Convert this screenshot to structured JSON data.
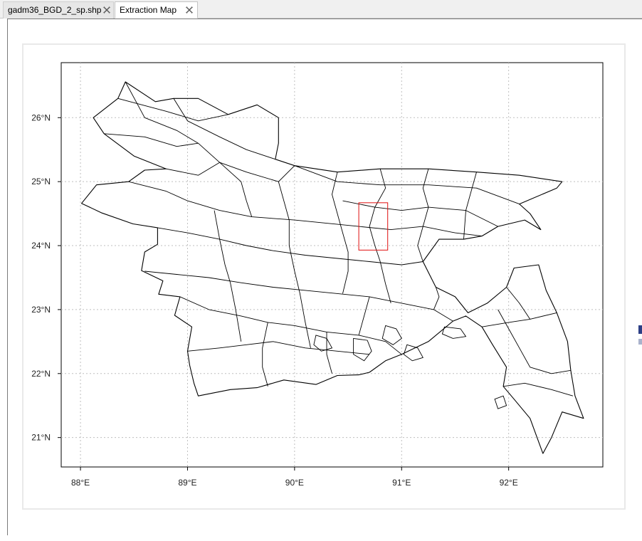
{
  "tabs": [
    {
      "label": "gadm36_BGD_2_sp.shp",
      "active": false
    },
    {
      "label": "Extraction Map",
      "active": true
    }
  ],
  "map": {
    "extent": {
      "lon_min": 87.82,
      "lon_max": 92.88,
      "lat_min": 20.54,
      "lat_max": 26.86
    },
    "x_ticks": [
      {
        "value": 88,
        "label": "88°E"
      },
      {
        "value": 89,
        "label": "89°E"
      },
      {
        "value": 90,
        "label": "90°E"
      },
      {
        "value": 91,
        "label": "91°E"
      },
      {
        "value": 92,
        "label": "92°E"
      }
    ],
    "y_ticks": [
      {
        "value": 26,
        "label": "26°N"
      },
      {
        "value": 25,
        "label": "25°N"
      },
      {
        "value": 24,
        "label": "24°N"
      },
      {
        "value": 23,
        "label": "23°N"
      },
      {
        "value": 22,
        "label": "22°N"
      },
      {
        "value": 21,
        "label": "21°N"
      }
    ],
    "grid": true,
    "grid_color": "#bfbfbf",
    "boundary_color": "#000000",
    "extraction_box": {
      "lon_min": 90.6,
      "lon_max": 90.87,
      "lat_min": 23.93,
      "lat_max": 24.67,
      "color": "#e01010"
    },
    "country_outline": [
      [
        88.01,
        24.66
      ],
      [
        88.2,
        24.51
      ],
      [
        88.49,
        24.34
      ],
      [
        88.72,
        24.28
      ],
      [
        88.72,
        24.02
      ],
      [
        88.6,
        23.9
      ],
      [
        88.57,
        23.61
      ],
      [
        88.77,
        23.45
      ],
      [
        88.73,
        23.24
      ],
      [
        88.93,
        23.2
      ],
      [
        88.88,
        22.91
      ],
      [
        89.04,
        22.73
      ],
      [
        89.0,
        22.35
      ],
      [
        89.02,
        22.13
      ],
      [
        89.06,
        21.85
      ],
      [
        89.1,
        21.65
      ],
      [
        89.4,
        21.75
      ],
      [
        89.65,
        21.78
      ],
      [
        89.9,
        21.9
      ],
      [
        90.2,
        21.83
      ],
      [
        90.4,
        21.97
      ],
      [
        90.6,
        21.98
      ],
      [
        90.7,
        22.02
      ],
      [
        90.85,
        22.2
      ],
      [
        91.0,
        22.3
      ],
      [
        91.25,
        22.5
      ],
      [
        91.48,
        22.82
      ],
      [
        91.6,
        22.9
      ],
      [
        91.75,
        22.73
      ],
      [
        91.85,
        22.45
      ],
      [
        91.98,
        22.1
      ],
      [
        91.95,
        21.8
      ],
      [
        92.05,
        21.6
      ],
      [
        92.2,
        21.3
      ],
      [
        92.32,
        20.75
      ],
      [
        92.4,
        21.0
      ],
      [
        92.5,
        21.4
      ],
      [
        92.7,
        21.3
      ],
      [
        92.62,
        21.65
      ],
      [
        92.58,
        22.05
      ],
      [
        92.55,
        22.5
      ],
      [
        92.45,
        22.95
      ],
      [
        92.35,
        23.3
      ],
      [
        92.28,
        23.7
      ],
      [
        92.05,
        23.65
      ],
      [
        91.98,
        23.35
      ],
      [
        91.8,
        23.1
      ],
      [
        91.62,
        22.95
      ],
      [
        91.5,
        23.2
      ],
      [
        91.32,
        23.35
      ],
      [
        91.2,
        23.75
      ],
      [
        91.35,
        24.1
      ],
      [
        91.58,
        24.1
      ],
      [
        91.75,
        24.15
      ],
      [
        91.9,
        24.3
      ],
      [
        92.15,
        24.4
      ],
      [
        92.3,
        24.25
      ],
      [
        92.2,
        24.5
      ],
      [
        92.1,
        24.65
      ],
      [
        92.45,
        24.9
      ],
      [
        92.5,
        25.0
      ],
      [
        92.1,
        25.1
      ],
      [
        91.7,
        25.15
      ],
      [
        91.25,
        25.2
      ],
      [
        90.8,
        25.2
      ],
      [
        90.4,
        25.15
      ],
      [
        90.0,
        25.25
      ],
      [
        89.82,
        25.35
      ],
      [
        89.85,
        25.6
      ],
      [
        89.85,
        26.0
      ],
      [
        89.65,
        26.2
      ],
      [
        89.38,
        26.05
      ],
      [
        89.1,
        26.3
      ],
      [
        88.87,
        26.3
      ],
      [
        88.7,
        26.25
      ],
      [
        88.42,
        26.56
      ],
      [
        88.35,
        26.3
      ],
      [
        88.12,
        26.0
      ],
      [
        88.22,
        25.75
      ],
      [
        88.5,
        25.4
      ],
      [
        88.8,
        25.2
      ],
      [
        88.6,
        25.18
      ],
      [
        88.45,
        25.0
      ],
      [
        88.15,
        24.95
      ],
      [
        88.01,
        24.66
      ]
    ],
    "district_lines": [
      [
        [
          88.45,
          25.0
        ],
        [
          88.8,
          24.85
        ],
        [
          89.0,
          24.7
        ],
        [
          89.3,
          24.55
        ],
        [
          89.6,
          24.45
        ],
        [
          90.0,
          24.4
        ],
        [
          90.3,
          24.35
        ],
        [
          90.6,
          24.3
        ],
        [
          90.9,
          24.25
        ],
        [
          91.2,
          24.3
        ],
        [
          91.5,
          24.2
        ],
        [
          91.75,
          24.15
        ]
      ],
      [
        [
          88.72,
          24.28
        ],
        [
          89.0,
          24.2
        ],
        [
          89.3,
          24.1
        ],
        [
          89.55,
          24.0
        ],
        [
          89.8,
          23.92
        ],
        [
          90.1,
          23.85
        ],
        [
          90.4,
          23.8
        ],
        [
          90.7,
          23.75
        ],
        [
          91.0,
          23.7
        ],
        [
          91.2,
          23.75
        ]
      ],
      [
        [
          88.6,
          23.6
        ],
        [
          88.9,
          23.55
        ],
        [
          89.2,
          23.5
        ],
        [
          89.5,
          23.42
        ],
        [
          89.8,
          23.35
        ],
        [
          90.1,
          23.3
        ],
        [
          90.4,
          23.25
        ],
        [
          90.7,
          23.2
        ],
        [
          91.0,
          23.1
        ],
        [
          91.3,
          23.0
        ],
        [
          91.48,
          22.82
        ]
      ],
      [
        [
          88.93,
          23.2
        ],
        [
          89.2,
          23.0
        ],
        [
          89.5,
          22.9
        ],
        [
          89.75,
          22.8
        ],
        [
          90.0,
          22.75
        ],
        [
          90.3,
          22.65
        ],
        [
          90.6,
          22.6
        ],
        [
          90.85,
          22.5
        ],
        [
          91.0,
          22.3
        ]
      ],
      [
        [
          89.0,
          22.35
        ],
        [
          89.3,
          22.4
        ],
        [
          89.55,
          22.45
        ],
        [
          89.8,
          22.5
        ],
        [
          90.1,
          22.4
        ],
        [
          90.4,
          22.35
        ],
        [
          90.7,
          22.3
        ]
      ],
      [
        [
          88.42,
          26.56
        ],
        [
          88.6,
          26.0
        ],
        [
          88.9,
          25.8
        ],
        [
          89.1,
          25.6
        ],
        [
          89.3,
          25.3
        ],
        [
          89.5,
          25.0
        ],
        [
          89.55,
          24.7
        ],
        [
          89.6,
          24.45
        ]
      ],
      [
        [
          88.87,
          26.3
        ],
        [
          89.0,
          25.95
        ],
        [
          89.3,
          25.7
        ],
        [
          89.55,
          25.5
        ],
        [
          89.82,
          25.35
        ]
      ],
      [
        [
          88.35,
          26.3
        ],
        [
          88.8,
          26.1
        ],
        [
          89.1,
          25.95
        ],
        [
          89.38,
          26.05
        ]
      ],
      [
        [
          88.22,
          25.75
        ],
        [
          88.6,
          25.7
        ],
        [
          88.9,
          25.55
        ],
        [
          89.1,
          25.6
        ]
      ],
      [
        [
          88.8,
          25.2
        ],
        [
          89.1,
          25.1
        ],
        [
          89.3,
          25.3
        ],
        [
          89.55,
          25.15
        ],
        [
          89.85,
          25.0
        ],
        [
          90.0,
          25.25
        ]
      ],
      [
        [
          89.25,
          24.55
        ],
        [
          89.3,
          24.1
        ],
        [
          89.35,
          23.7
        ],
        [
          89.4,
          23.42
        ],
        [
          89.45,
          23.0
        ],
        [
          89.5,
          22.5
        ]
      ],
      [
        [
          89.85,
          25.0
        ],
        [
          89.9,
          24.7
        ],
        [
          89.95,
          24.4
        ],
        [
          89.95,
          24.0
        ],
        [
          90.0,
          23.6
        ],
        [
          90.05,
          23.25
        ],
        [
          90.1,
          22.8
        ],
        [
          90.15,
          22.4
        ]
      ],
      [
        [
          90.4,
          25.15
        ],
        [
          90.35,
          24.8
        ],
        [
          90.4,
          24.5
        ],
        [
          90.45,
          24.2
        ],
        [
          90.5,
          23.9
        ],
        [
          90.5,
          23.6
        ],
        [
          90.45,
          23.25
        ]
      ],
      [
        [
          90.8,
          25.2
        ],
        [
          90.85,
          24.9
        ],
        [
          90.75,
          24.6
        ],
        [
          90.7,
          24.3
        ],
        [
          90.75,
          24.0
        ],
        [
          90.8,
          23.75
        ],
        [
          90.85,
          23.4
        ],
        [
          90.9,
          23.1
        ]
      ],
      [
        [
          91.25,
          25.2
        ],
        [
          91.2,
          24.9
        ],
        [
          91.25,
          24.6
        ],
        [
          91.2,
          24.3
        ],
        [
          91.15,
          24.0
        ],
        [
          91.2,
          23.75
        ]
      ],
      [
        [
          91.7,
          25.15
        ],
        [
          91.65,
          24.85
        ],
        [
          91.6,
          24.55
        ],
        [
          91.58,
          24.1
        ]
      ],
      [
        [
          90.0,
          25.25
        ],
        [
          90.4,
          25.0
        ],
        [
          90.8,
          24.95
        ],
        [
          91.25,
          24.95
        ],
        [
          91.7,
          24.9
        ],
        [
          92.1,
          24.65
        ]
      ],
      [
        [
          90.45,
          24.7
        ],
        [
          90.75,
          24.6
        ],
        [
          91.0,
          24.55
        ],
        [
          91.25,
          24.6
        ],
        [
          91.6,
          24.55
        ],
        [
          91.9,
          24.3
        ]
      ],
      [
        [
          91.9,
          23.0
        ],
        [
          92.0,
          22.7
        ],
        [
          92.1,
          22.4
        ],
        [
          92.2,
          22.1
        ],
        [
          92.4,
          22.0
        ],
        [
          92.58,
          22.05
        ]
      ],
      [
        [
          91.75,
          22.73
        ],
        [
          92.0,
          22.8
        ],
        [
          92.2,
          22.85
        ],
        [
          92.45,
          22.95
        ]
      ],
      [
        [
          91.98,
          23.35
        ],
        [
          92.1,
          23.1
        ],
        [
          92.2,
          22.85
        ]
      ],
      [
        [
          91.95,
          21.8
        ],
        [
          92.15,
          21.85
        ],
        [
          92.4,
          21.75
        ],
        [
          92.6,
          21.65
        ]
      ],
      [
        [
          91.3,
          23.0
        ],
        [
          91.35,
          23.2
        ],
        [
          91.32,
          23.35
        ]
      ],
      [
        [
          89.75,
          22.8
        ],
        [
          89.7,
          22.4
        ],
        [
          89.7,
          22.1
        ],
        [
          89.75,
          21.8
        ]
      ],
      [
        [
          90.3,
          22.65
        ],
        [
          90.3,
          22.3
        ],
        [
          90.35,
          22.0
        ]
      ],
      [
        [
          90.7,
          23.2
        ],
        [
          90.65,
          22.9
        ],
        [
          90.6,
          22.6
        ]
      ]
    ],
    "islands": [
      [
        [
          90.55,
          22.55
        ],
        [
          90.68,
          22.52
        ],
        [
          90.72,
          22.35
        ],
        [
          90.65,
          22.2
        ],
        [
          90.55,
          22.3
        ],
        [
          90.55,
          22.55
        ]
      ],
      [
        [
          90.85,
          22.75
        ],
        [
          90.95,
          22.7
        ],
        [
          91.0,
          22.55
        ],
        [
          90.92,
          22.45
        ],
        [
          90.82,
          22.55
        ],
        [
          90.85,
          22.75
        ]
      ],
      [
        [
          91.4,
          22.73
        ],
        [
          91.55,
          22.7
        ],
        [
          91.6,
          22.58
        ],
        [
          91.48,
          22.55
        ],
        [
          91.38,
          22.62
        ],
        [
          91.4,
          22.73
        ]
      ],
      [
        [
          91.87,
          21.6
        ],
        [
          91.95,
          21.65
        ],
        [
          91.98,
          21.5
        ],
        [
          91.9,
          21.45
        ],
        [
          91.87,
          21.6
        ]
      ],
      [
        [
          91.05,
          22.45
        ],
        [
          91.15,
          22.4
        ],
        [
          91.2,
          22.25
        ],
        [
          91.1,
          22.2
        ],
        [
          91.02,
          22.3
        ],
        [
          91.05,
          22.45
        ]
      ],
      [
        [
          90.2,
          22.6
        ],
        [
          90.3,
          22.55
        ],
        [
          90.35,
          22.4
        ],
        [
          90.25,
          22.35
        ],
        [
          90.18,
          22.45
        ],
        [
          90.2,
          22.6
        ]
      ]
    ]
  }
}
